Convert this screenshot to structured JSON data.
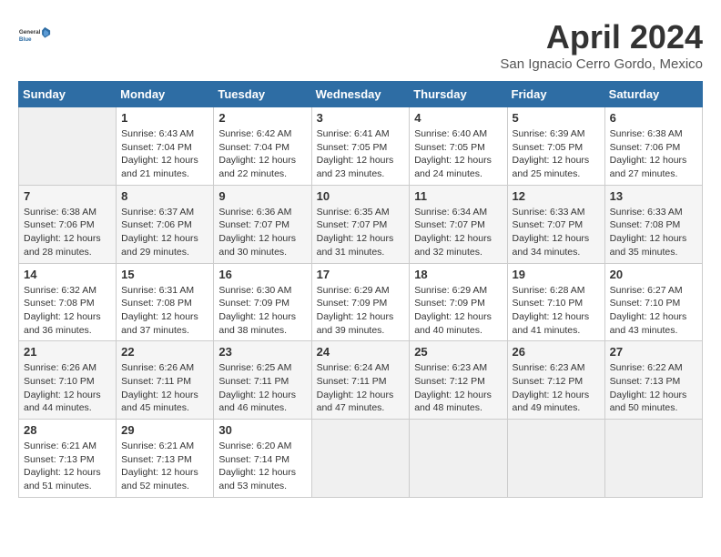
{
  "header": {
    "logo_line1": "General",
    "logo_line2": "Blue",
    "month_year": "April 2024",
    "location": "San Ignacio Cerro Gordo, Mexico"
  },
  "days_of_week": [
    "Sunday",
    "Monday",
    "Tuesday",
    "Wednesday",
    "Thursday",
    "Friday",
    "Saturday"
  ],
  "weeks": [
    [
      {
        "day": "",
        "info": ""
      },
      {
        "day": "1",
        "info": "Sunrise: 6:43 AM\nSunset: 7:04 PM\nDaylight: 12 hours\nand 21 minutes."
      },
      {
        "day": "2",
        "info": "Sunrise: 6:42 AM\nSunset: 7:04 PM\nDaylight: 12 hours\nand 22 minutes."
      },
      {
        "day": "3",
        "info": "Sunrise: 6:41 AM\nSunset: 7:05 PM\nDaylight: 12 hours\nand 23 minutes."
      },
      {
        "day": "4",
        "info": "Sunrise: 6:40 AM\nSunset: 7:05 PM\nDaylight: 12 hours\nand 24 minutes."
      },
      {
        "day": "5",
        "info": "Sunrise: 6:39 AM\nSunset: 7:05 PM\nDaylight: 12 hours\nand 25 minutes."
      },
      {
        "day": "6",
        "info": "Sunrise: 6:38 AM\nSunset: 7:06 PM\nDaylight: 12 hours\nand 27 minutes."
      }
    ],
    [
      {
        "day": "7",
        "info": "Sunrise: 6:38 AM\nSunset: 7:06 PM\nDaylight: 12 hours\nand 28 minutes."
      },
      {
        "day": "8",
        "info": "Sunrise: 6:37 AM\nSunset: 7:06 PM\nDaylight: 12 hours\nand 29 minutes."
      },
      {
        "day": "9",
        "info": "Sunrise: 6:36 AM\nSunset: 7:07 PM\nDaylight: 12 hours\nand 30 minutes."
      },
      {
        "day": "10",
        "info": "Sunrise: 6:35 AM\nSunset: 7:07 PM\nDaylight: 12 hours\nand 31 minutes."
      },
      {
        "day": "11",
        "info": "Sunrise: 6:34 AM\nSunset: 7:07 PM\nDaylight: 12 hours\nand 32 minutes."
      },
      {
        "day": "12",
        "info": "Sunrise: 6:33 AM\nSunset: 7:07 PM\nDaylight: 12 hours\nand 34 minutes."
      },
      {
        "day": "13",
        "info": "Sunrise: 6:33 AM\nSunset: 7:08 PM\nDaylight: 12 hours\nand 35 minutes."
      }
    ],
    [
      {
        "day": "14",
        "info": "Sunrise: 6:32 AM\nSunset: 7:08 PM\nDaylight: 12 hours\nand 36 minutes."
      },
      {
        "day": "15",
        "info": "Sunrise: 6:31 AM\nSunset: 7:08 PM\nDaylight: 12 hours\nand 37 minutes."
      },
      {
        "day": "16",
        "info": "Sunrise: 6:30 AM\nSunset: 7:09 PM\nDaylight: 12 hours\nand 38 minutes."
      },
      {
        "day": "17",
        "info": "Sunrise: 6:29 AM\nSunset: 7:09 PM\nDaylight: 12 hours\nand 39 minutes."
      },
      {
        "day": "18",
        "info": "Sunrise: 6:29 AM\nSunset: 7:09 PM\nDaylight: 12 hours\nand 40 minutes."
      },
      {
        "day": "19",
        "info": "Sunrise: 6:28 AM\nSunset: 7:10 PM\nDaylight: 12 hours\nand 41 minutes."
      },
      {
        "day": "20",
        "info": "Sunrise: 6:27 AM\nSunset: 7:10 PM\nDaylight: 12 hours\nand 43 minutes."
      }
    ],
    [
      {
        "day": "21",
        "info": "Sunrise: 6:26 AM\nSunset: 7:10 PM\nDaylight: 12 hours\nand 44 minutes."
      },
      {
        "day": "22",
        "info": "Sunrise: 6:26 AM\nSunset: 7:11 PM\nDaylight: 12 hours\nand 45 minutes."
      },
      {
        "day": "23",
        "info": "Sunrise: 6:25 AM\nSunset: 7:11 PM\nDaylight: 12 hours\nand 46 minutes."
      },
      {
        "day": "24",
        "info": "Sunrise: 6:24 AM\nSunset: 7:11 PM\nDaylight: 12 hours\nand 47 minutes."
      },
      {
        "day": "25",
        "info": "Sunrise: 6:23 AM\nSunset: 7:12 PM\nDaylight: 12 hours\nand 48 minutes."
      },
      {
        "day": "26",
        "info": "Sunrise: 6:23 AM\nSunset: 7:12 PM\nDaylight: 12 hours\nand 49 minutes."
      },
      {
        "day": "27",
        "info": "Sunrise: 6:22 AM\nSunset: 7:13 PM\nDaylight: 12 hours\nand 50 minutes."
      }
    ],
    [
      {
        "day": "28",
        "info": "Sunrise: 6:21 AM\nSunset: 7:13 PM\nDaylight: 12 hours\nand 51 minutes."
      },
      {
        "day": "29",
        "info": "Sunrise: 6:21 AM\nSunset: 7:13 PM\nDaylight: 12 hours\nand 52 minutes."
      },
      {
        "day": "30",
        "info": "Sunrise: 6:20 AM\nSunset: 7:14 PM\nDaylight: 12 hours\nand 53 minutes."
      },
      {
        "day": "",
        "info": ""
      },
      {
        "day": "",
        "info": ""
      },
      {
        "day": "",
        "info": ""
      },
      {
        "day": "",
        "info": ""
      }
    ]
  ]
}
